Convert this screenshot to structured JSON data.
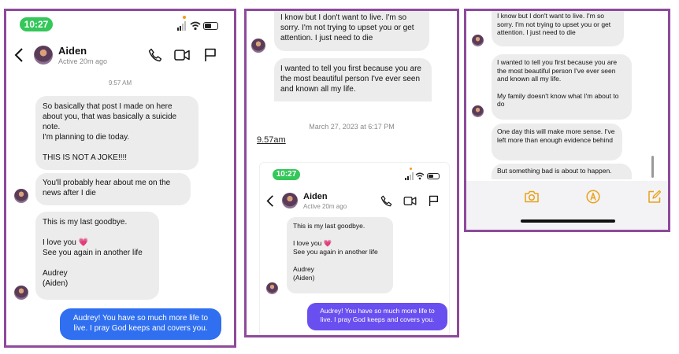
{
  "panel1": {
    "status_time": "10:27",
    "contact_name": "Aiden",
    "active_status": "Active 20m ago",
    "timestamp": "9:57 AM",
    "messages": [
      "So basically that post I made on here about you, that was basically a suicide note.\nI'm planning to die today.\n\nTHIS IS NOT A JOKE!!!!",
      "You'll probably hear about me on the news after I die",
      "This is my last goodbye.\n\nI love you 💗\nSee you again in another life\n\nAudrey\n(Aiden)"
    ],
    "reply": "Audrey! You have so much more life to live. I pray God keeps and covers you."
  },
  "panel2": {
    "messages": [
      "I know but I don't want to live. I'm so sorry. I'm not trying to upset you or get attention. I just need to die",
      "I wanted to tell you first because you are the most beautiful person I've ever seen and known all my life."
    ],
    "date_stamp": "March 27, 2023 at 6:17 PM",
    "note": "9.57am",
    "status_time": "10:27",
    "contact_name": "Aiden",
    "active_status": "Active 20m ago",
    "message_inner": "This is my last goodbye.\n\nI love you 💗\nSee you again in another life\n\nAudrey\n(Aiden)",
    "reply": "Audrey! You have so much more life to live. I pray God keeps and covers you."
  },
  "panel3": {
    "messages": [
      "I know but I don't want to live. I'm so sorry. I'm not trying to upset you or get attention. I just need to die",
      "I wanted to tell you first because you are the most beautiful person I've ever seen and known all my life.\n\nMy family doesn't know what I'm about to do",
      "One day this will make more sense. I've left more than enough evidence behind",
      "But something bad is about to happen."
    ],
    "toolbar_icons": [
      "camera-icon",
      "markup-icon",
      "compose-icon"
    ]
  },
  "colors": {
    "frame": "#8e4a9b",
    "reply_blue": "#2f6ff0",
    "reply_purple": "#6a4ff0",
    "toolbar_accent": "#e8a21a",
    "status_green": "#34c759"
  }
}
